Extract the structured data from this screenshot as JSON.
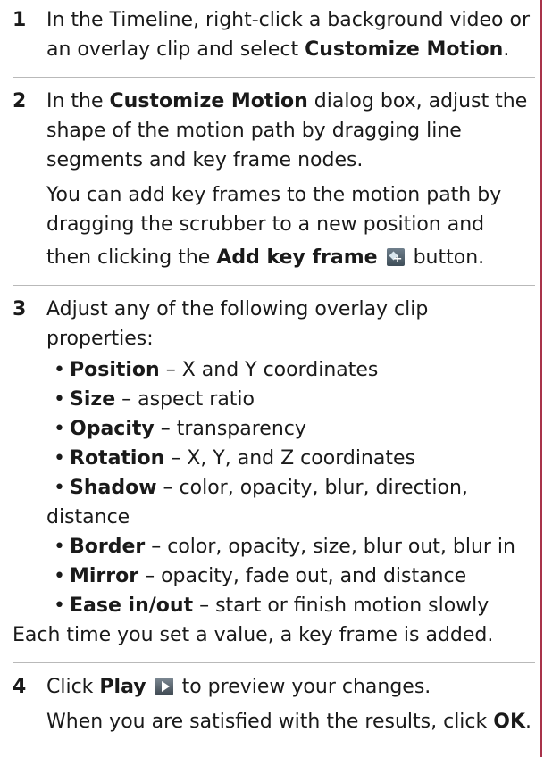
{
  "steps": [
    {
      "number": "1",
      "pre": "In the Timeline, right-click a background video or an overlay clip and select ",
      "bold": "Customize Motion",
      "post": "."
    },
    {
      "number": "2",
      "pre": "In the ",
      "bold": "Customize Motion",
      "post": " dialog box, adjust the shape of the motion path by dragging line segments and key frame nodes.",
      "para2": "You can add key frames to the motion path by dragging the scrubber to a new position and",
      "para3_pre": "then clicking the ",
      "para3_bold": "Add key frame",
      "para3_post": " button.",
      "icon": "add-key-frame-icon"
    },
    {
      "number": "3",
      "text": "Adjust any of the following overlay clip properties:",
      "properties": [
        {
          "name": "Position",
          "desc": " – X and Y coordinates"
        },
        {
          "name": "Size",
          "desc": " – aspect ratio"
        },
        {
          "name": "Opacity",
          "desc": " – transparency"
        },
        {
          "name": "Rotation",
          "desc": " – X, Y, and Z coordinates"
        },
        {
          "name": "Shadow",
          "desc": " – color, opacity, blur, direction,",
          "tail": "distance"
        },
        {
          "name": "Border",
          "desc": " – color, opacity, size, blur out, blur in"
        },
        {
          "name": "Mirror",
          "desc": " – opacity, fade out, and distance"
        },
        {
          "name": "Ease in/out",
          "desc": " – start or finish motion slowly"
        }
      ],
      "after": "Each time you set a value, a key frame is added."
    },
    {
      "number": "4",
      "pre": "Click ",
      "bold": "Play",
      "post": " to preview your changes.",
      "icon": "play-icon",
      "para2_pre": "When you are satisfied with the results, click ",
      "para2_bold": "OK",
      "para2_post": "."
    }
  ],
  "colors": {
    "accent_rule": "#a8324a",
    "divider": "#b9b9b9",
    "text": "#1a1a1a"
  }
}
